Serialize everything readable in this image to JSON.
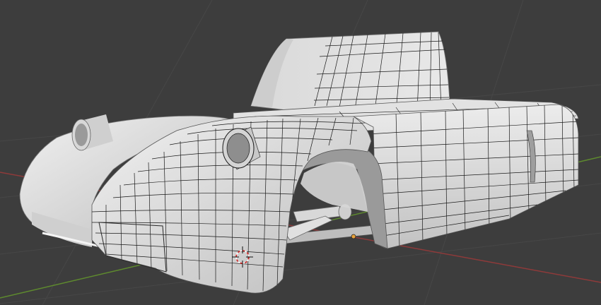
{
  "viewport": {
    "mode": "edit-mode",
    "shading": "solid",
    "overlay": "wireframe",
    "object": "car-body-mesh"
  },
  "colors": {
    "background": "#3d3d3d",
    "grid": "#4a4a4a",
    "x_axis": "#8e3a3a",
    "y_axis": "#5e8a2e",
    "mesh_light": "#e4e4e4",
    "mesh_mid": "#cfcfcf",
    "mesh_dark": "#a9a9a9",
    "wire": "#1a1a1a",
    "origin": "#e8a23a",
    "cursor_red": "#d22222"
  },
  "icons": {
    "cursor": "3d-cursor-icon",
    "origin": "object-origin-icon"
  }
}
